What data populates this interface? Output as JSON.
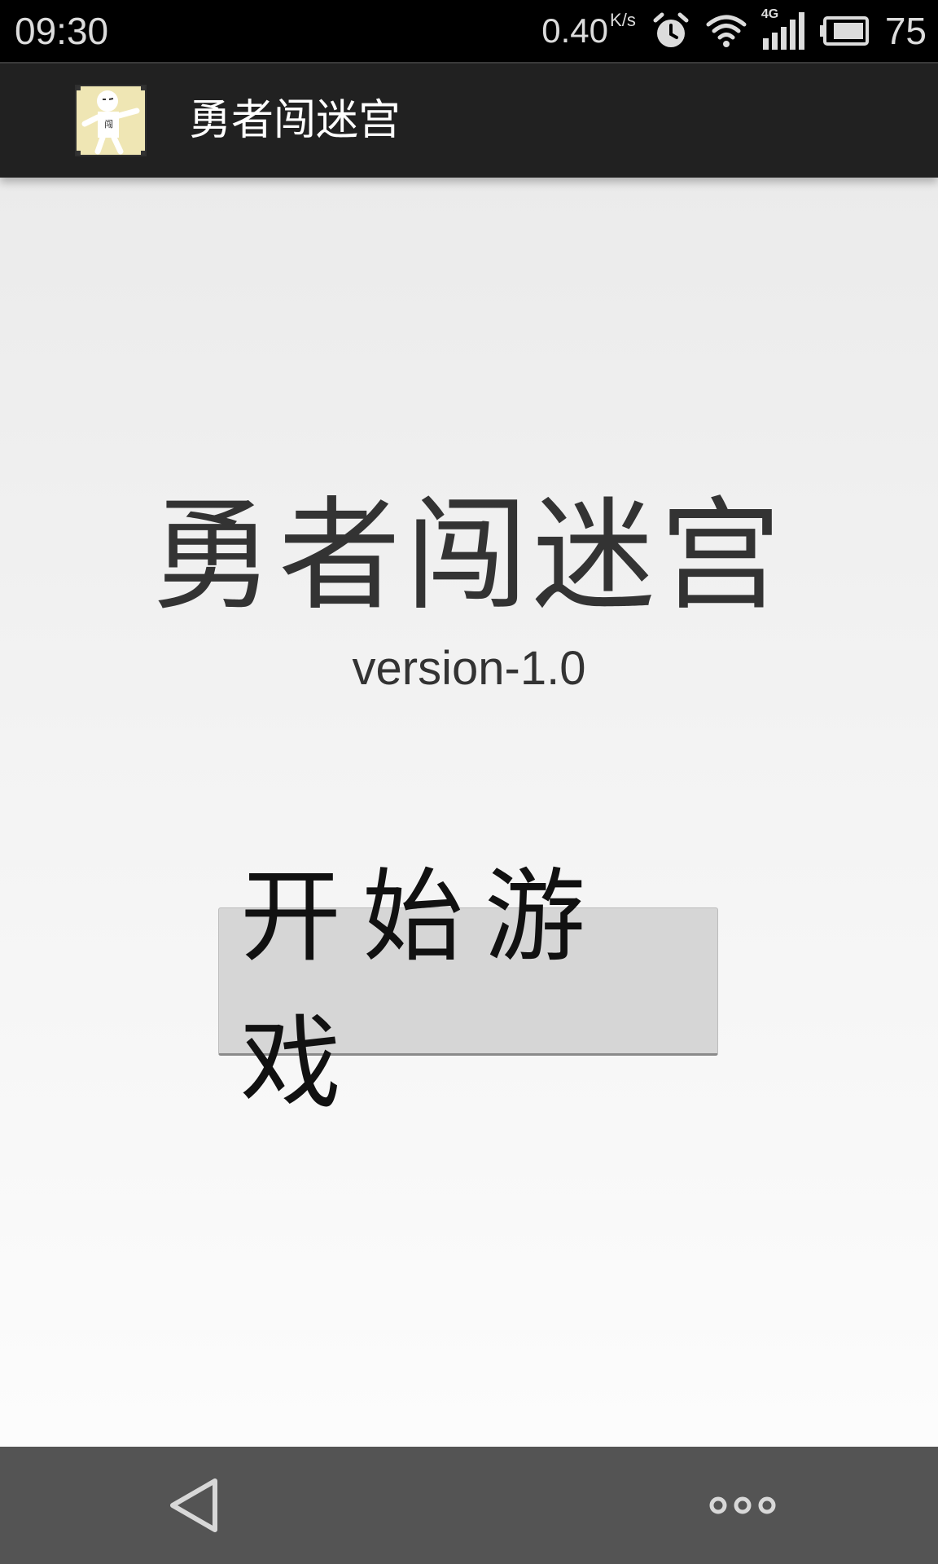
{
  "status_bar": {
    "time": "09:30",
    "net_speed": "0.40",
    "net_speed_unit": "K/s",
    "network_type": "4G",
    "battery_level": "75",
    "icons": [
      "alarm-clock-icon",
      "wifi-icon",
      "signal-icon",
      "battery-icon"
    ]
  },
  "action_bar": {
    "title": "勇者闯迷宫",
    "icon_text": "闯"
  },
  "main": {
    "game_title": "勇者闯迷宫",
    "version": "version-1.0",
    "start_button_label": "开始游戏"
  },
  "nav_bar": {
    "icons": [
      "back-triangle-icon",
      "more-dots-icon"
    ]
  },
  "colors": {
    "status_bar_bg": "#000000",
    "action_bar_bg": "#212121",
    "content_bg": "#f0f0f0",
    "button_bg": "#d6d6d6",
    "nav_bar_bg": "#545454",
    "text_dark": "#333333"
  }
}
